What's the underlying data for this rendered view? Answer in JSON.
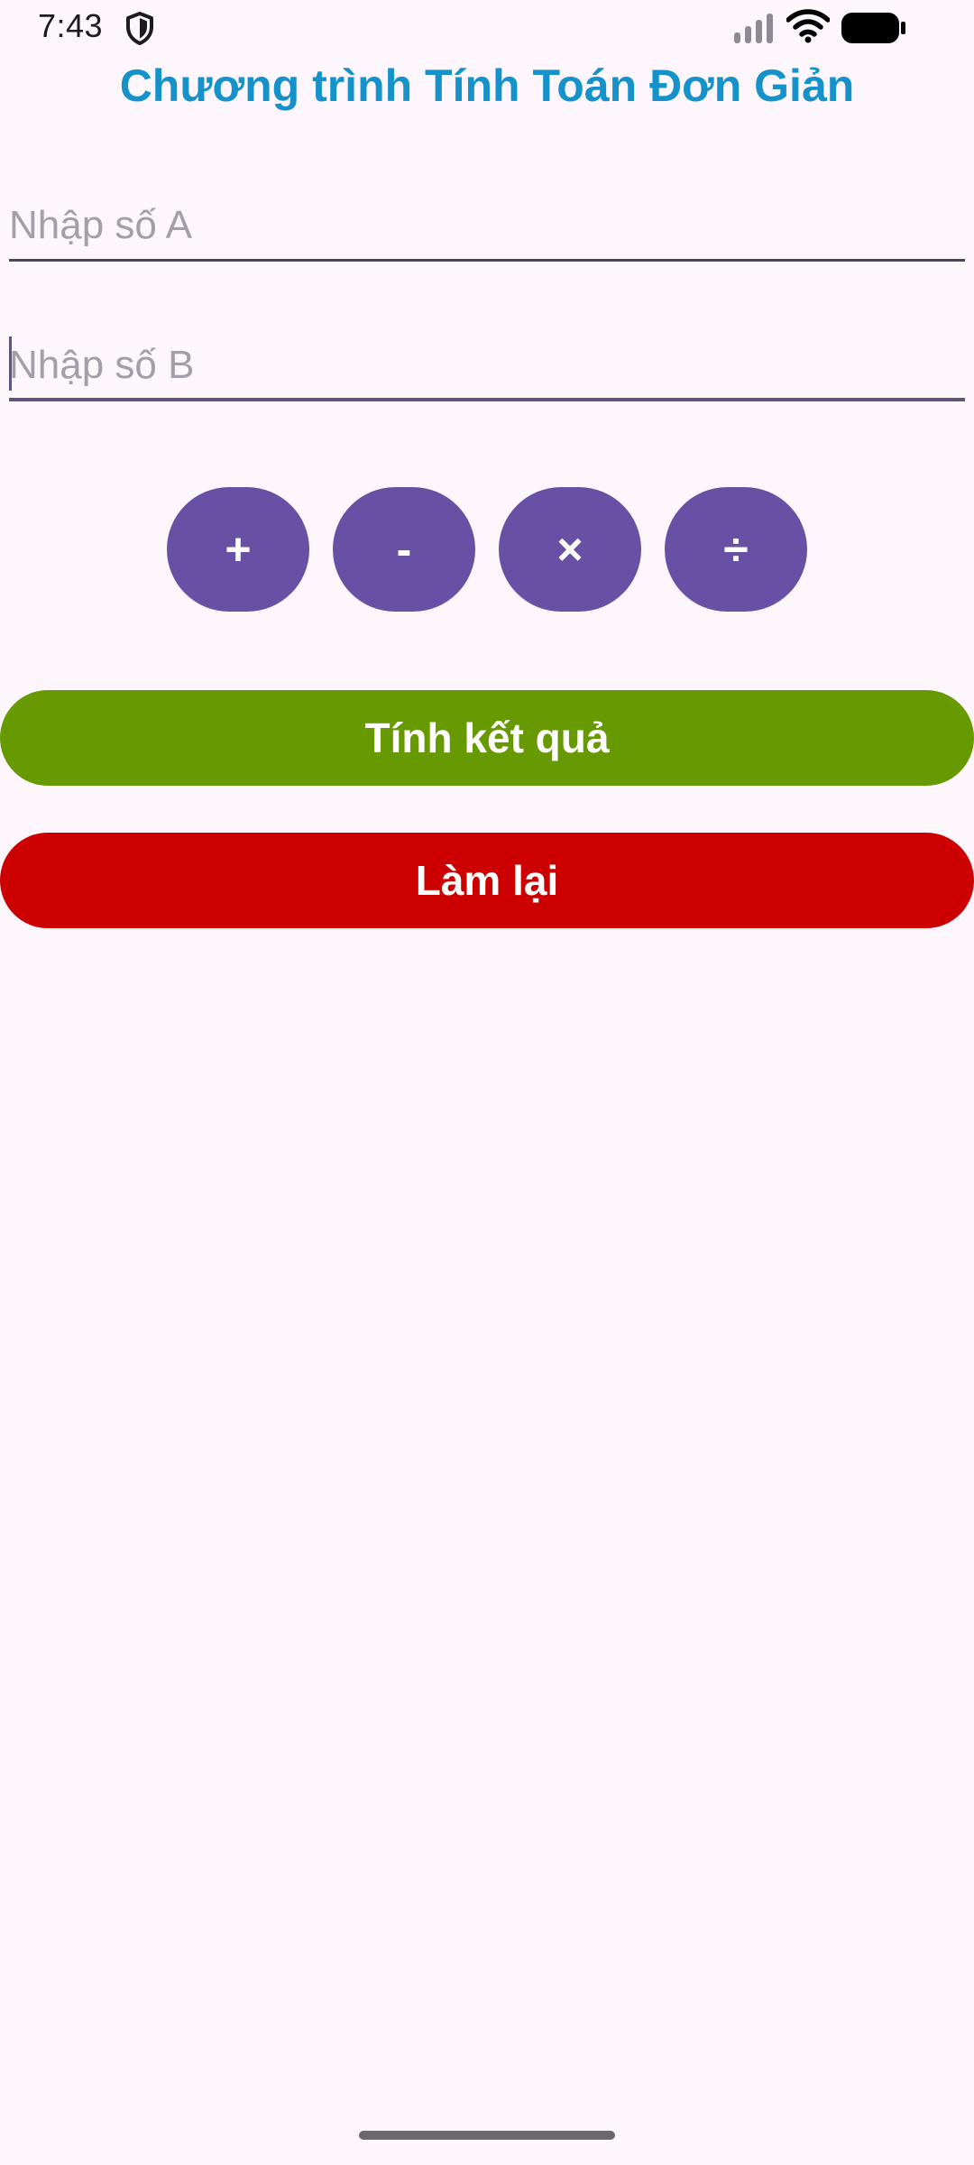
{
  "status_bar": {
    "time": "7:43",
    "icons": [
      "shield-icon",
      "signal-icon",
      "wifi-icon",
      "battery-icon"
    ]
  },
  "page": {
    "title": "Chương trình Tính Toán Đơn Giản"
  },
  "inputs": {
    "a": {
      "value": "",
      "placeholder": "Nhập số A"
    },
    "b": {
      "value": "",
      "placeholder": "Nhập số B",
      "focused": true
    }
  },
  "operators": [
    "+",
    "-",
    "×",
    "÷"
  ],
  "actions": {
    "calculate_label": "Tính kết quả",
    "reset_label": "Làm lại"
  },
  "colors": {
    "background": "#fdf6fd",
    "title": "#1592c9",
    "operator": "#6850a4",
    "calculate": "#669a00",
    "reset": "#cc0000"
  }
}
